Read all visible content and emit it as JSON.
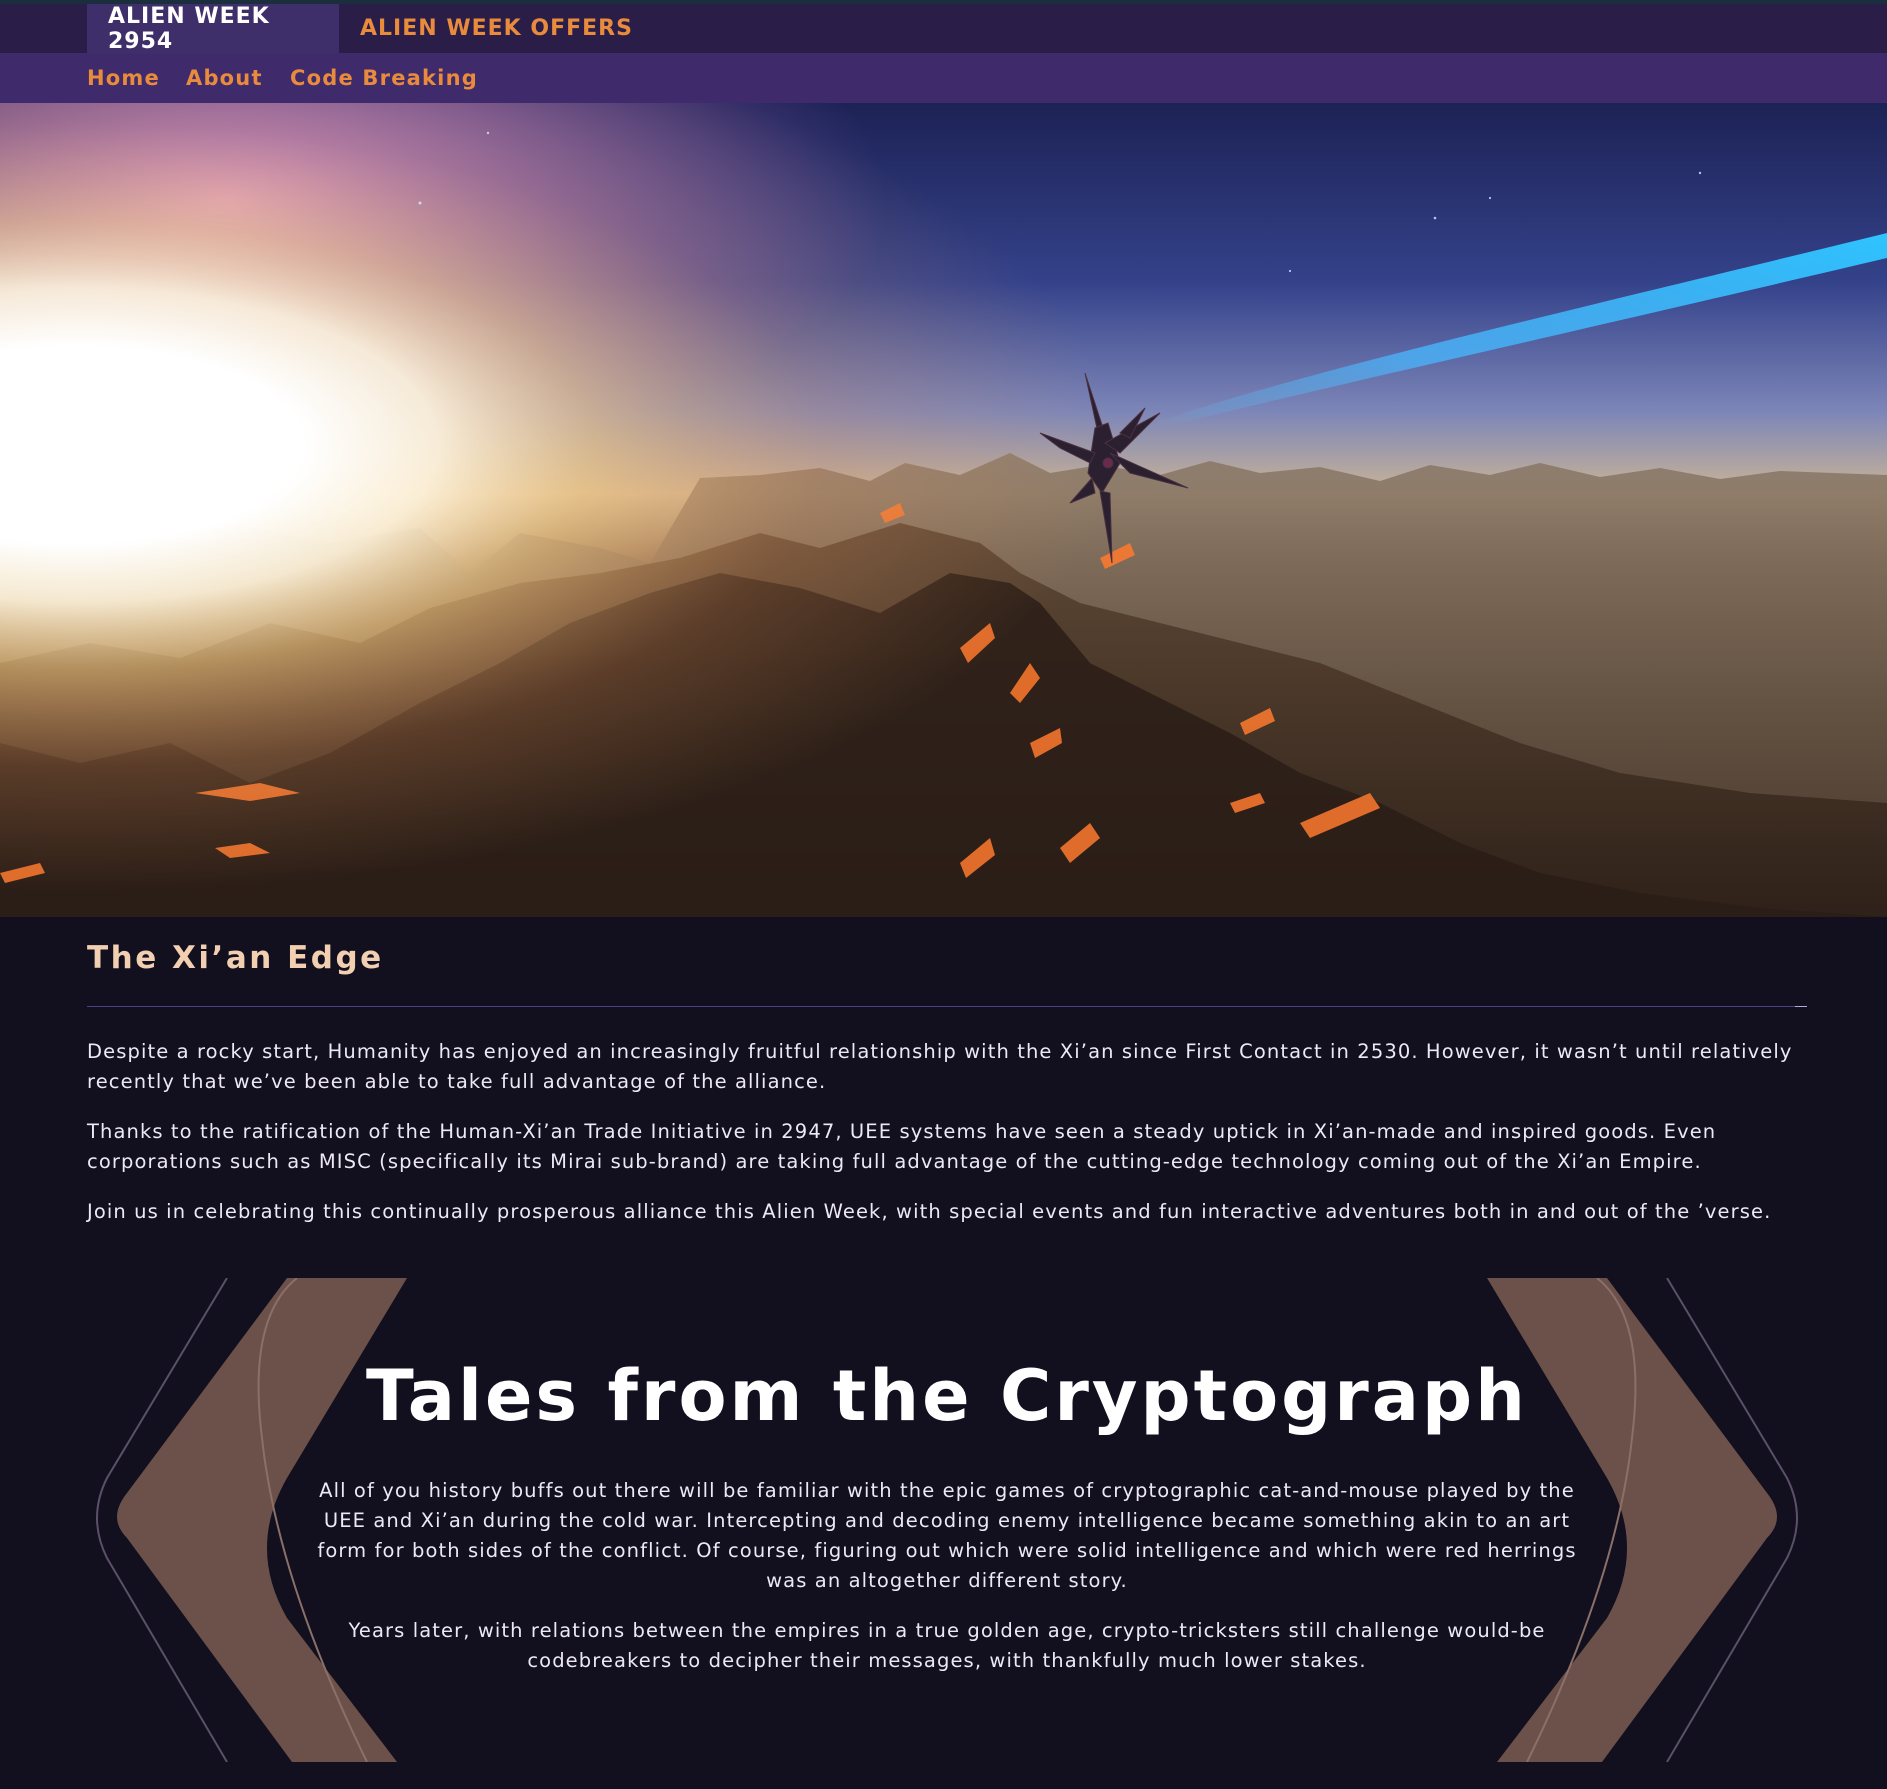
{
  "top_nav": {
    "active_tab": "ALIEN WEEK 2954",
    "offers_tab": "ALIEN WEEK OFFERS"
  },
  "sub_nav": {
    "items": [
      "Home",
      "About",
      "Code Breaking"
    ]
  },
  "intro": {
    "title": "The Xi’an Edge",
    "paragraphs": [
      "Despite a rocky start, Humanity has enjoyed an increasingly fruitful relationship with the Xi’an since First Contact in 2530. However, it wasn’t until relatively recently that we’ve been able to take full advantage of the alliance.",
      "Thanks to the ratification of the Human-Xi’an Trade Initiative in 2947, UEE systems have seen a steady uptick in Xi’an-made and inspired goods. Even corporations such as MISC (specifically its Mirai sub-brand) are taking full advantage of the cutting-edge technology coming out of the Xi’an Empire.",
      "Join us in celebrating this continually prosperous alliance this Alien Week, with special events and fun interactive adventures both in and out of the ’verse."
    ]
  },
  "crypto": {
    "title": "Tales from the Cryptograph",
    "paragraphs": [
      "All of you history buffs out there will be familiar with the epic games of cryptographic cat-and-mouse played by the UEE and Xi’an during the cold war. Intercepting and decoding enemy intelligence became something akin to an art form for both sides of the conflict. Of course, figuring out which were solid intelligence and which were red herrings was an altogether different story.",
      "Years later, with relations between the empires in a true golden age, crypto-tricksters still challenge would-be codebreakers to decipher their messages, with thankfully much lower stakes."
    ]
  },
  "colors": {
    "page_bg": "#120f1f",
    "top_bar": "#2a1d48",
    "active_tab": "#3e2e6a",
    "sub_nav": "#3f2b6b",
    "accent_orange": "#e98b3d",
    "title_peach": "#f3cfb1",
    "bracket_brown": "#6b5149"
  }
}
